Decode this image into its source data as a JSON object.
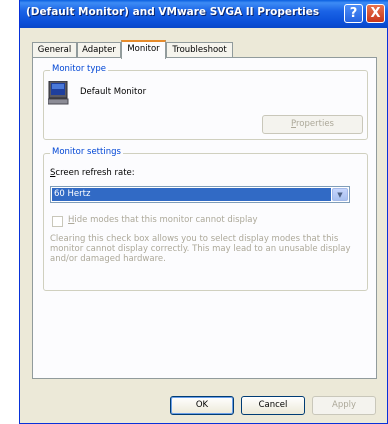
{
  "window": {
    "title": "(Default Monitor) and VMware SVGA II Properties",
    "help_glyph": "?",
    "close_glyph": "X"
  },
  "tabs": [
    "General",
    "Adapter",
    "Monitor",
    "Troubleshoot"
  ],
  "active_tab": "Monitor",
  "monitor_type": {
    "group_label": "Monitor type",
    "monitor_name": "Default Monitor",
    "properties_button": "Properties",
    "properties_enabled": false
  },
  "monitor_settings": {
    "group_label": "Monitor settings",
    "refresh_label": "Screen refresh rate:",
    "refresh_value": "60 Hertz",
    "hide_modes_label": "Hide modes that this monitor cannot display",
    "hide_modes_checked": false,
    "hide_modes_enabled": false,
    "description": "Clearing this check box allows you to select display modes that this monitor cannot display correctly. This may lead to an unusable display and/or damaged hardware."
  },
  "buttons": {
    "ok": "OK",
    "cancel": "Cancel",
    "apply": "Apply"
  },
  "colors": {
    "titlebar": "#0a4fd8",
    "group_label": "#0046d5",
    "selection": "#316ac5",
    "disabled_text": "#aca899"
  }
}
